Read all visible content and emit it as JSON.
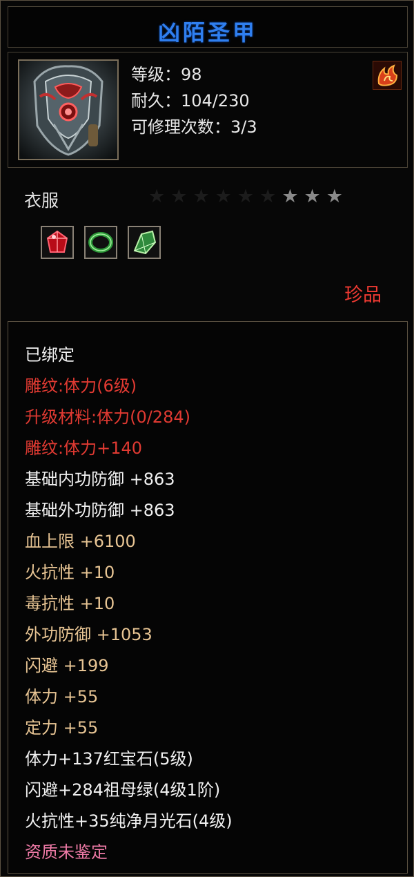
{
  "item": {
    "name": "凶陌圣甲",
    "level_label": "等级：98",
    "durability_label": "耐久：104/230",
    "repair_label": "可修理次数：3/3",
    "category": "衣服",
    "rarity": "珍品",
    "stars": {
      "total": 9,
      "lit": 3
    },
    "icons": {
      "portrait": "armor-portrait-icon",
      "element": "fire-element-icon",
      "gems": [
        "red-gem-icon",
        "green-ring-gem-icon",
        "green-crystal-gem-icon"
      ]
    }
  },
  "colors": {
    "title": "#2f7ff0",
    "white": "#f0f0f0",
    "red": "#e13a32",
    "tan": "#e8c594",
    "pink": "#ee7aa6"
  },
  "details": {
    "bound": "已绑定",
    "engraving": "雕纹:体力(6级)",
    "upgrade_material": "升级材料:体力(0/284)",
    "engraving_bonus": "雕纹:体力+140",
    "base_inner_defense": "基础内功防御  +863",
    "base_outer_defense": "基础外功防御  +863",
    "hp_max": "血上限  +6100",
    "fire_res": "火抗性  +10",
    "poison_res": "毒抗性  +10",
    "outer_defense": "外功防御  +1053",
    "dodge": "闪避  +199",
    "stamina": "体力  +55",
    "focus": "定力  +55",
    "gem_line_1": "体力+137红宝石(5级)",
    "gem_line_2": "闪避+284祖母绿(4级1阶)",
    "gem_line_3": "火抗性+35纯净月光石(4级)",
    "quality": "资质未鉴定"
  }
}
